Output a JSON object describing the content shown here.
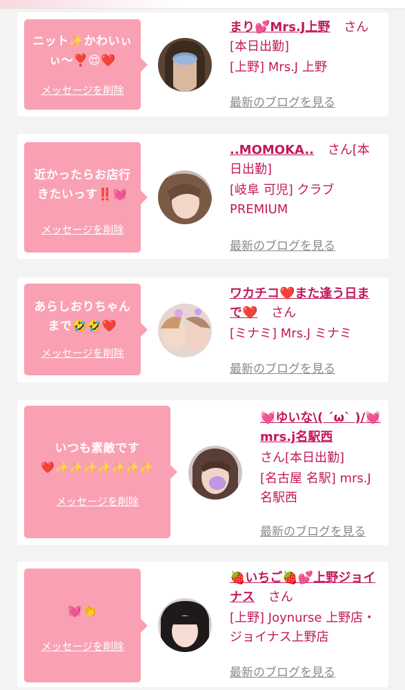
{
  "colors": {
    "bubble": "#f9a1b3",
    "name": "#c2185b",
    "blog_link": "#8a8a8a",
    "background": "#f4f3f3"
  },
  "cards": [
    {
      "message_lines": [
        "ニット✨かわいぃ",
        "ぃ〜❣️😍❤️"
      ],
      "delete_label": "メッセージを削除",
      "name": "まり💕Mrs.J上野",
      "suffix": "さん[本日出勤]",
      "shop": "[上野] Mrs.J 上野",
      "blog_label": "最新のブログを見る"
    },
    {
      "message_lines": [
        "近かったらお店行",
        "きたいっす‼️💓"
      ],
      "delete_label": "メッセージを削除",
      "name": "..MOMOKA..",
      "suffix": "さん[本日出勤]",
      "shop": "[岐阜 可児] クラブPREMIUM",
      "blog_label": "最新のブログを見る"
    },
    {
      "message_lines": [
        "あらしおりちゃん",
        "まで🤣🤣❤️"
      ],
      "delete_label": "メッセージを削除",
      "name": "ワカチコ❤️また逢う日まで❤️",
      "suffix": "さん",
      "shop": "[ミナミ] Mrs.J ミナミ",
      "blog_label": "最新のブログを見る"
    },
    {
      "message_lines": [
        "いつも素敵です",
        "❤️✨✨✨✨✨✨✨"
      ],
      "delete_label": "メッセージを削除",
      "name": "💓ゆいな\\( ´ω` )/💓mrs.j名駅西",
      "suffix": "さん[本日出勤]",
      "shop": "[名古屋 名駅] mrs.J 名駅西",
      "blog_label": "最新のブログを見る"
    },
    {
      "message_lines": [
        "💓👏"
      ],
      "delete_label": "メッセージを削除",
      "name": "🍓いちご🍓💕上野ジョイナス",
      "suffix": "さん",
      "shop": "[上野] Joynurse 上野店・ジョイナス上野店",
      "blog_label": "最新のブログを見る"
    }
  ]
}
